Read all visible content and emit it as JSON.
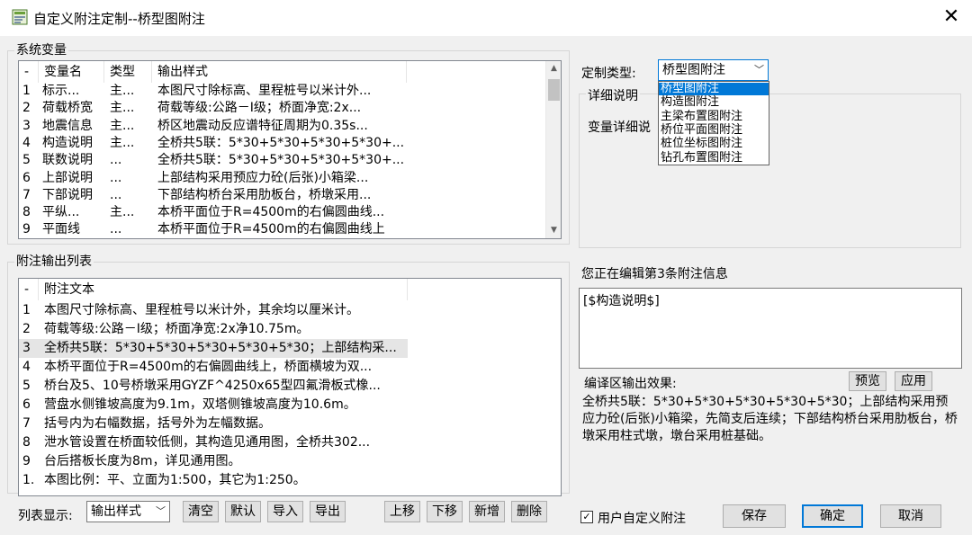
{
  "window": {
    "title": "自定义附注定制--桥型图附注",
    "close_symbol": "✕"
  },
  "system_vars": {
    "group_title": "系统变量",
    "headers": [
      "-",
      "变量名",
      "类型",
      "输出样式"
    ],
    "rows": [
      {
        "idx": "1",
        "name": "标示...",
        "type": "主...",
        "style": "本图尺寸除标高、里程桩号以米计外..."
      },
      {
        "idx": "2",
        "name": "荷载桥宽",
        "type": "主...",
        "style": "荷载等级:公路－Ⅰ级；桥面净宽:2x..."
      },
      {
        "idx": "3",
        "name": "地震信息",
        "type": "主...",
        "style": "桥区地震动反应谱特征周期为0.35s..."
      },
      {
        "idx": "4",
        "name": "构造说明",
        "type": "主...",
        "style": "全桥共5联：5*30+5*30+5*30+5*30+..."
      },
      {
        "idx": "5",
        "name": "联数说明",
        "type": "...",
        "style": "全桥共5联：5*30+5*30+5*30+5*30+..."
      },
      {
        "idx": "6",
        "name": "上部说明",
        "type": "...",
        "style": "上部结构采用预应力砼(后张)小箱梁..."
      },
      {
        "idx": "7",
        "name": "下部说明",
        "type": "...",
        "style": "下部结构桥台采用肋板台，桥墩采用..."
      },
      {
        "idx": "8",
        "name": "平纵...",
        "type": "主...",
        "style": "本桥平面位于R=4500m的右偏圆曲线..."
      },
      {
        "idx": "9",
        "name": "平面线",
        "type": "...",
        "style": "本桥平面位于R=4500m的右偏圆曲线上"
      }
    ]
  },
  "notes_list": {
    "group_title": "附注输出列表",
    "headers": [
      "-",
      "附注文本"
    ],
    "selected_index": 2,
    "rows": [
      {
        "idx": "1",
        "text": "本图尺寸除标高、里程桩号以米计外，其余均以厘米计。"
      },
      {
        "idx": "2",
        "text": "荷载等级:公路－Ⅰ级；桥面净宽:2x净10.75m。"
      },
      {
        "idx": "3",
        "text": "全桥共5联：5*30+5*30+5*30+5*30+5*30；上部结构采..."
      },
      {
        "idx": "4",
        "text": "本桥平面位于R=4500m的右偏圆曲线上，桥面横坡为双..."
      },
      {
        "idx": "5",
        "text": "桥台及5、10号桥墩采用GYZF^4250x65型四氟滑板式橡..."
      },
      {
        "idx": "6",
        "text": "营盘水侧锥坡高度为9.1m，双塔侧锥坡高度为10.6m。"
      },
      {
        "idx": "7",
        "text": "括号内为右幅数据，括号外为左幅数据。"
      },
      {
        "idx": "8",
        "text": "泄水管设置在桥面较低侧，其构造见通用图，全桥共302..."
      },
      {
        "idx": "9",
        "text": "台后搭板长度为8m，详见通用图。"
      },
      {
        "idx": "1.",
        "text": "本图比例：平、立面为1:500，其它为1:250。"
      }
    ]
  },
  "bottom_bar": {
    "list_display_label": "列表显示:",
    "list_display_value": "输出样式",
    "buttons": {
      "clear": "清空",
      "default": "默认",
      "import": "导入",
      "export": "导出",
      "move_up": "上移",
      "move_down": "下移",
      "add": "新增",
      "delete": "删除"
    }
  },
  "custom_type": {
    "label": "定制类型:",
    "value": "桥型图附注",
    "options": [
      "桥型图附注",
      "构造图附注",
      "主梁布置图附注",
      "桥位平面图附注",
      "桩位坐标图附注",
      "钻孔布置图附注"
    ],
    "active_index": 0
  },
  "detail": {
    "group_title": "详细说明",
    "var_detail_label": "变量详细说"
  },
  "editor": {
    "editing_label": "您正在编辑第3条附注信息",
    "text": "[$构造说明$]",
    "compile_label": "编译区输出效果:",
    "preview_button": "预览",
    "apply_button": "应用",
    "output_text": "全桥共5联：5*30+5*30+5*30+5*30+5*30；上部结构采用预应力砼(后张)小箱梁，先简支后连续；下部结构桥台采用肋板台，桥墩采用柱式墩，墩台采用桩基础。"
  },
  "footer": {
    "user_custom_label": "用户自定义附注",
    "user_custom_checked": "✓",
    "save_button": "保存",
    "ok_button": "确定",
    "cancel_button": "取消"
  }
}
